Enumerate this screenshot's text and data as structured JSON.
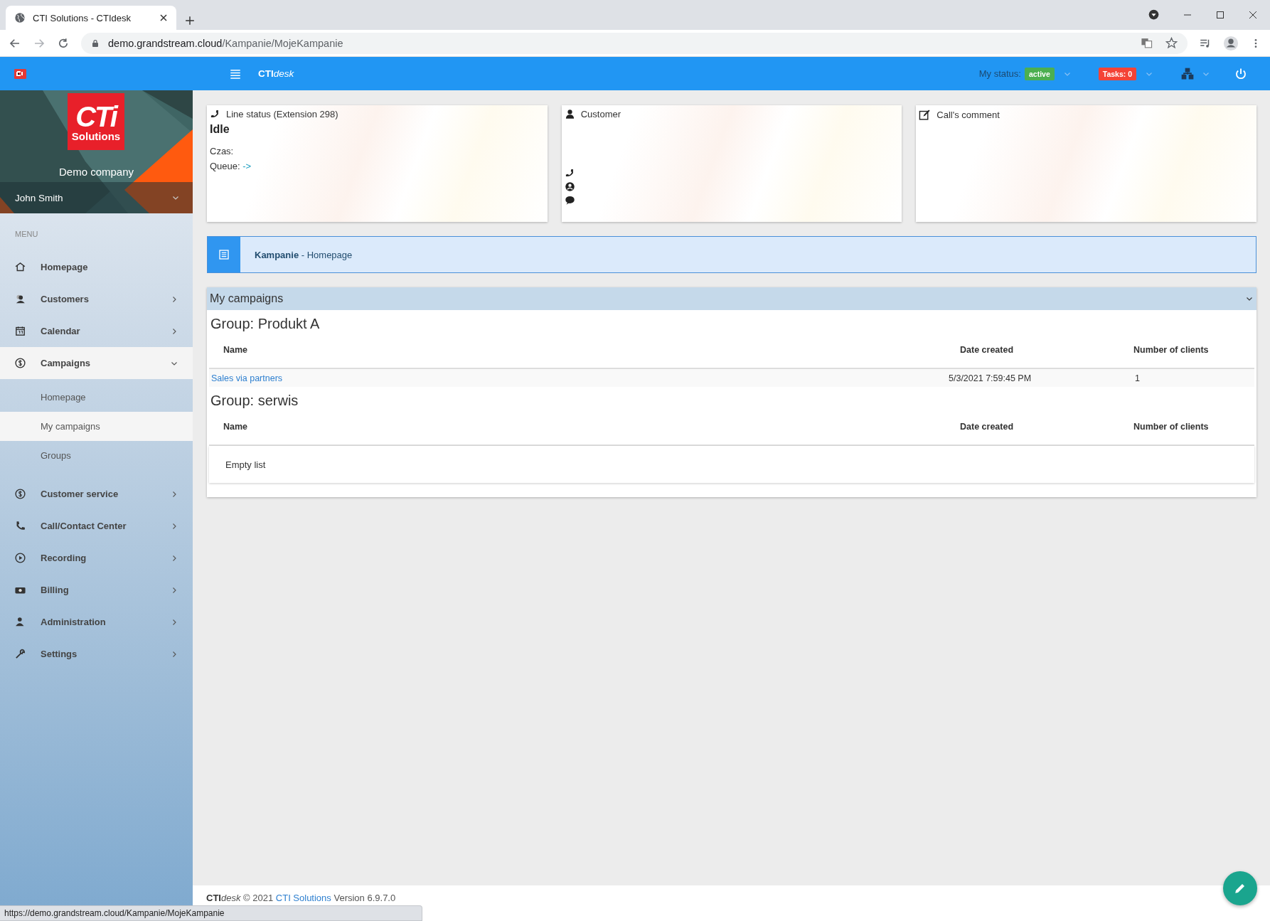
{
  "browser": {
    "tab_title": "CTI Solutions - CTIdesk",
    "url_host": "demo.grandstream.cloud",
    "url_path": "/Kampanie/MojeKampanie",
    "status_url": "https://demo.grandstream.cloud/Kampanie/MojeKampanie"
  },
  "header": {
    "brand": "CTI",
    "brand_suffix": "desk",
    "status_label": "My status:",
    "status": "active",
    "tasks": "Tasks: 0"
  },
  "sidebar": {
    "logo_top": "CTi",
    "logo_bottom": "Solutions",
    "company": "Demo company",
    "user": "John Smith",
    "menu_label": "MENU",
    "items": [
      {
        "label": "Homepage",
        "kind": "link",
        "selected": false
      },
      {
        "label": "Customers",
        "kind": "group",
        "expanded": false,
        "selected": false
      },
      {
        "label": "Calendar",
        "kind": "group",
        "expanded": false,
        "selected": false
      },
      {
        "label": "Campaigns",
        "kind": "group",
        "expanded": true,
        "selected": true,
        "children": [
          {
            "label": "Homepage",
            "selected": false
          },
          {
            "label": "My campaigns",
            "selected": true
          },
          {
            "label": "Groups",
            "selected": false
          }
        ]
      },
      {
        "label": "Customer service",
        "kind": "group",
        "expanded": false,
        "selected": false
      },
      {
        "label": "Call/Contact Center",
        "kind": "group",
        "expanded": false,
        "selected": false
      },
      {
        "label": "Recording",
        "kind": "group",
        "expanded": false,
        "selected": false
      },
      {
        "label": "Billing",
        "kind": "group",
        "expanded": false,
        "selected": false
      },
      {
        "label": "Administration",
        "kind": "group",
        "expanded": false,
        "selected": false
      },
      {
        "label": "Settings",
        "kind": "group",
        "expanded": false,
        "selected": false
      }
    ]
  },
  "cards": {
    "line": {
      "title": "Line status (Extension 298)",
      "state": "Idle",
      "time_label": "Czas:",
      "queue_label": "Queue:",
      "queue_value": "->"
    },
    "customer": {
      "title": "Customer"
    },
    "comment": {
      "title": "Call's comment"
    }
  },
  "breadcrumb": "**Kampanie** - Homepage",
  "panel": {
    "title": "My campaigns",
    "expanded": true,
    "groups": [
      {
        "title": "Group: Produkt A",
        "columns": [
          "Name",
          "Date created",
          "Number of clients"
        ],
        "rows": [
          {
            "name": "Sales via partners",
            "date": "5/3/2021 7:59:45 PM",
            "clients": "1"
          }
        ]
      },
      {
        "title": "Group: serwis",
        "columns": [
          "Name",
          "Date created",
          "Number of clients"
        ],
        "empty": "Empty list"
      }
    ]
  },
  "footer": {
    "brand": "CTI",
    "brand_suffix": "desk",
    "copyright": "© 2021",
    "link": "CTI Solutions",
    "version": "Version 6.9.7.0"
  }
}
